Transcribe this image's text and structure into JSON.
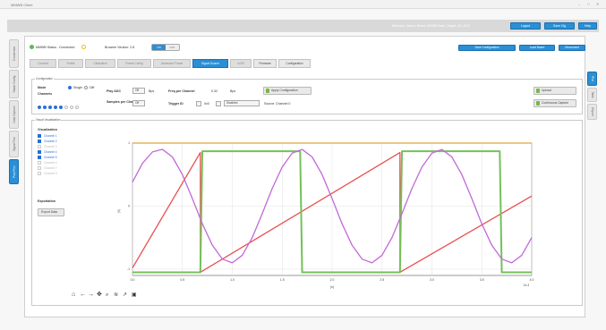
{
  "window": {
    "title": "MMWB Client"
  },
  "topbar": {
    "user_info": "Welcome, Admin | Board: MMWB-Base | Target: 40 | 2022",
    "buttons": [
      {
        "label": "Logout"
      },
      {
        "label": "Save Cfg"
      },
      {
        "label": "Help"
      }
    ]
  },
  "left_nav": [
    {
      "label": "Connection"
    },
    {
      "label": "Radar Config"
    },
    {
      "label": "Data Capture"
    },
    {
      "label": "Signal Proc"
    },
    {
      "label": "Post Proc"
    }
  ],
  "right_nav": [
    {
      "label": "Plot"
    },
    {
      "label": "Table"
    },
    {
      "label": "Export"
    }
  ],
  "status": {
    "device_status": "MMWB Status : Connected",
    "browser_version": "Browser Version: 2.8",
    "toggle_on": "ON",
    "toggle_off": "OFF",
    "actions": [
      "Save Configuration",
      "Load Board",
      "Disconnect"
    ]
  },
  "tabs": [
    {
      "label": "Connect"
    },
    {
      "label": "Profile"
    },
    {
      "label": "Calibration"
    },
    {
      "label": "Frame Config"
    },
    {
      "label": "Advanced Frame"
    },
    {
      "label": "Signal Source"
    },
    {
      "label": "LVDS"
    },
    {
      "label": "Firmware"
    },
    {
      "label": "Configuration"
    }
  ],
  "config": {
    "legend": "Configuration",
    "mode_label": "Mode",
    "mode_single": "Single",
    "mode_diff": "Diff",
    "channels_label": "Channels",
    "play_adc_label": "Play ADC",
    "play_adc_value": "Off",
    "play_adc_unit": "Bps",
    "samples_label": "Samples per Channel",
    "samples_value": "Off",
    "freq_label": "Freq per Channel",
    "freq_value": "0.32",
    "freq_unit": "Bps",
    "trigger_label": "Trigger ID",
    "trigger_value": "0x0",
    "trigger_mode": "Disabled",
    "source_label": "Source",
    "source_value": "Channel 0",
    "apply_button": "Apply Configuration",
    "upload_button": "Upload",
    "continuous_button": "Continuous Capture"
  },
  "waveforms": {
    "legend": "Visual Visualization",
    "vis_label": "Visualization",
    "channels": [
      {
        "name": "Channel 1",
        "color": "#2a6fd6",
        "on": true
      },
      {
        "name": "Channel 2",
        "color": "#2a6fd6",
        "on": true
      },
      {
        "name": "Channel 3",
        "color": "#2a6fd6",
        "on": false
      },
      {
        "name": "Channel 4",
        "color": "#2a6fd6",
        "on": true
      },
      {
        "name": "Channel 5",
        "color": "#2a6fd6",
        "on": true
      },
      {
        "name": "Channel 6",
        "color": "#2a6fd6",
        "on": false
      },
      {
        "name": "Channel 7",
        "color": "#2a6fd6",
        "on": false
      },
      {
        "name": "Channel 8",
        "color": "#2a6fd6",
        "on": false
      }
    ],
    "export_label": "Exportation",
    "export_button": "Export Data"
  },
  "chart_data": {
    "type": "line",
    "title": "",
    "xlabel": "(s)",
    "ylabel": "(V)",
    "x_unit_label": "1e-3",
    "xlim": [
      0,
      4.0
    ],
    "ylim": [
      -1.1,
      1.0
    ],
    "x_ticks": [
      "0.0",
      "0.5",
      "1.0",
      "1.5",
      "2.0",
      "2.5",
      "3.0",
      "3.5",
      "4.0"
    ],
    "y_ticks": [
      "1",
      "0",
      "-1"
    ],
    "grid": true,
    "series": [
      {
        "color": "#e6a23c",
        "x": [
          0,
          4.0
        ],
        "y": [
          1.0,
          1.0
        ]
      },
      {
        "color": "#e94f4f",
        "x": [
          0,
          0.68,
          0.68,
          2.68,
          2.68,
          4.0
        ],
        "y": [
          -0.98,
          0.85,
          -1.05,
          0.85,
          -1.05,
          0.16
        ]
      },
      {
        "color": "#74c05a",
        "x": [
          0,
          0.68,
          0.7,
          1.68,
          1.7,
          2.68,
          2.7,
          3.68,
          3.7,
          4.0
        ],
        "y": [
          -1.05,
          -1.05,
          0.87,
          0.87,
          -1.05,
          -1.05,
          0.87,
          0.87,
          -1.05,
          -1.05
        ]
      },
      {
        "color": "#c06ad6",
        "x": [
          0,
          0.1,
          0.2,
          0.3,
          0.4,
          0.5,
          0.6,
          0.7,
          0.8,
          0.9,
          1.0,
          1.1,
          1.2,
          1.3,
          1.4,
          1.5,
          1.6,
          1.7,
          1.8,
          1.9,
          2.0,
          2.1,
          2.2,
          2.3,
          2.4,
          2.5,
          2.6,
          2.7,
          2.8,
          2.9,
          3.0,
          3.1,
          3.2,
          3.3,
          3.4,
          3.5,
          3.6,
          3.7,
          3.8,
          3.9,
          4.0
        ],
        "y": [
          0.38,
          0.68,
          0.86,
          0.9,
          0.78,
          0.5,
          0.12,
          -0.28,
          -0.62,
          -0.84,
          -0.9,
          -0.78,
          -0.5,
          -0.12,
          0.28,
          0.62,
          0.84,
          0.9,
          0.78,
          0.5,
          0.12,
          -0.28,
          -0.62,
          -0.84,
          -0.9,
          -0.78,
          -0.5,
          -0.12,
          0.28,
          0.62,
          0.84,
          0.9,
          0.78,
          0.5,
          0.12,
          -0.28,
          -0.62,
          -0.84,
          -0.9,
          -0.78,
          -0.5
        ]
      }
    ]
  },
  "plot_toolbar": [
    "home-icon",
    "back-icon",
    "forward-icon",
    "pan-icon",
    "zoom-icon",
    "configure-icon",
    "edit-axis-icon",
    "save-icon"
  ]
}
